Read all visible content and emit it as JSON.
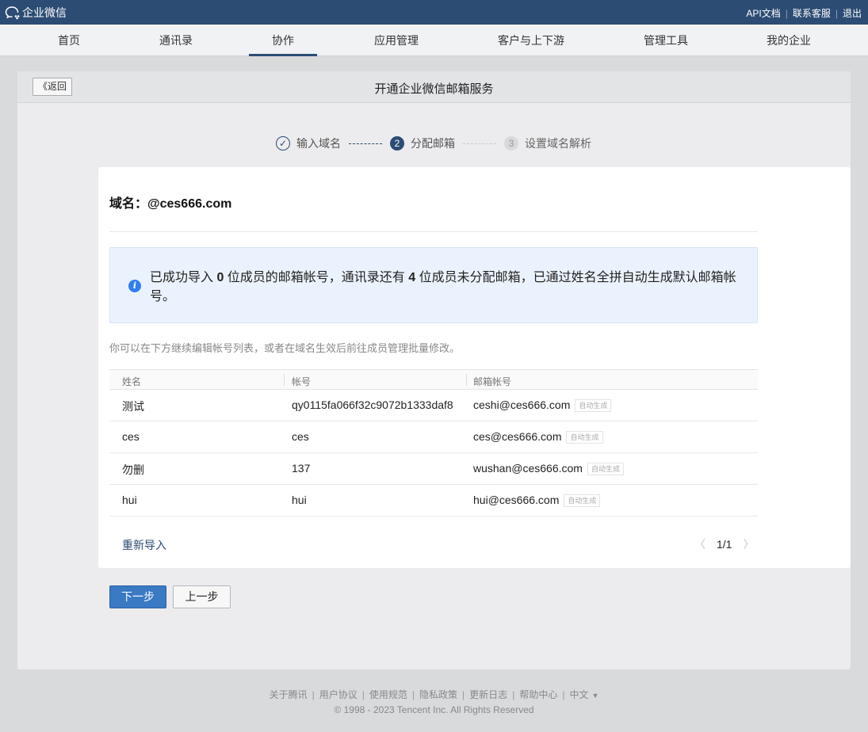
{
  "app": {
    "title": "企业微信"
  },
  "top_links": [
    "API文档",
    "联系客服",
    "退出"
  ],
  "nav": {
    "items": [
      "首页",
      "通讯录",
      "协作",
      "应用管理",
      "客户与上下游",
      "管理工具",
      "我的企业"
    ],
    "active": "协作"
  },
  "panel": {
    "back_label": "《返回",
    "title": "开通企业微信邮箱服务"
  },
  "steps": [
    {
      "num": "✓",
      "label": "输入域名",
      "state": "done"
    },
    {
      "num": "2",
      "label": "分配邮箱",
      "state": "current"
    },
    {
      "num": "3",
      "label": "设置域名解析",
      "state": "todo"
    }
  ],
  "domain": {
    "label": "域名：@ces666.com"
  },
  "notice": {
    "text_1": "已成功导入 ",
    "count_imported": "0",
    "text_2": " 位成员的邮箱帐号，通讯录还有 ",
    "count_unassigned": "4",
    "text_3": " 位成员未分配邮箱，已通过姓名全拼自动生成默认邮箱帐号。"
  },
  "hint": "你可以在下方继续编辑帐号列表，或者在域名生效后前往成员管理批量修改。",
  "table": {
    "columns": [
      "姓名",
      "帐号",
      "邮箱帐号"
    ],
    "rows": [
      {
        "name": "测试",
        "account": "qy0115fa066f32c9072b1333daf8",
        "email": "ceshi@ces666.com",
        "tag": "自动生成"
      },
      {
        "name": "ces",
        "account": "ces",
        "email": "ces@ces666.com",
        "tag": "自动生成"
      },
      {
        "name": "勿删",
        "account": "137",
        "email": "wushan@ces666.com",
        "tag": "自动生成"
      },
      {
        "name": "hui",
        "account": "hui",
        "email": "hui@ces666.com",
        "tag": "自动生成"
      }
    ]
  },
  "reimport_label": "重新导入",
  "pagination": {
    "page": "1/1"
  },
  "buttons": {
    "next": "下一步",
    "prev": "上一步"
  },
  "footer": {
    "links": [
      "关于腾讯",
      "用户协议",
      "使用规范",
      "隐私政策",
      "更新日志",
      "帮助中心",
      "中文"
    ],
    "copyright": "© 1998 - 2023 Tencent Inc. All Rights Reserved"
  },
  "colors": {
    "brand": "#2c4c73",
    "primary_button": "#3a79c4",
    "info": "#2f7ff2"
  }
}
